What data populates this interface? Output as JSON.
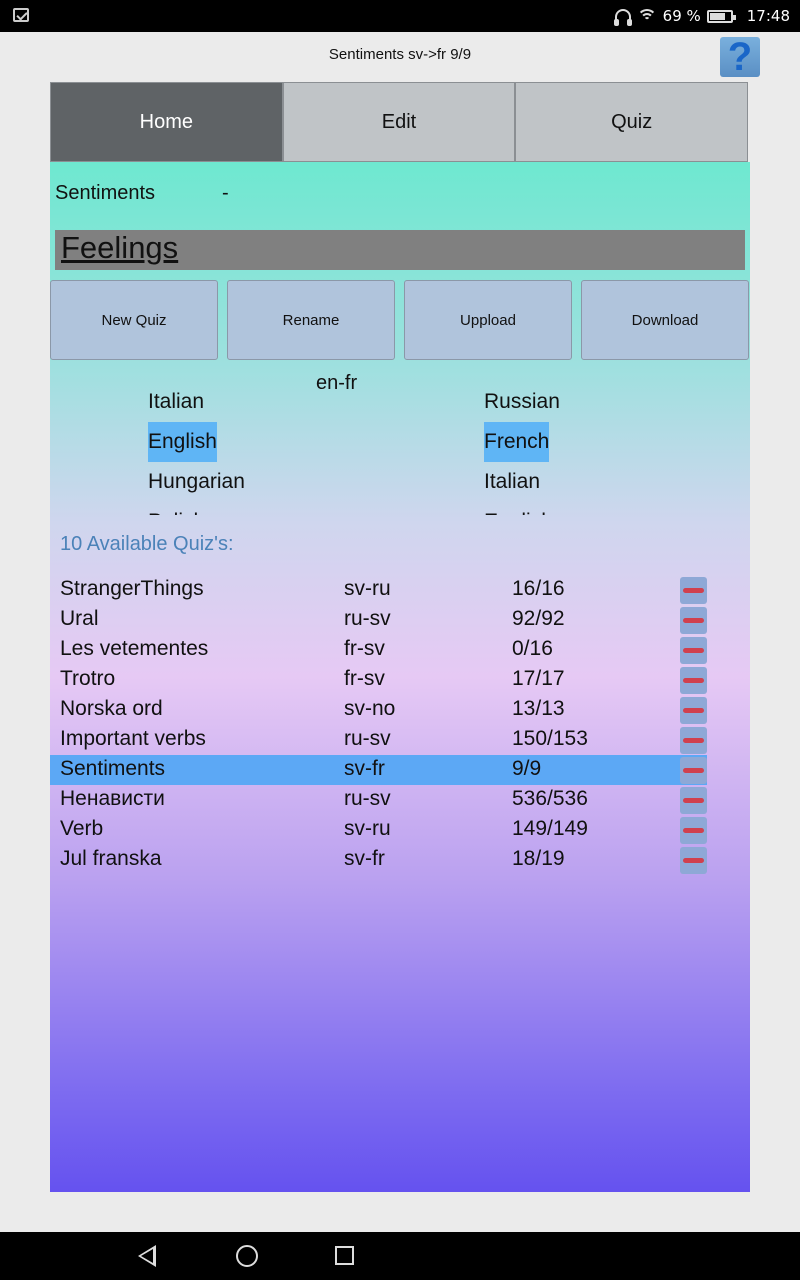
{
  "status_bar": {
    "battery": "69 %",
    "time": "17:48"
  },
  "header": {
    "title": "Sentiments sv->fr 9/9",
    "help_label": "?"
  },
  "tabs": [
    {
      "label": "Home",
      "active": true
    },
    {
      "label": "Edit",
      "active": false
    },
    {
      "label": "Quiz",
      "active": false
    }
  ],
  "current_quiz": {
    "name": "Sentiments",
    "separator": "-"
  },
  "category": {
    "label": "Feelings"
  },
  "actions": {
    "new_quiz": "New Quiz",
    "rename": "Rename",
    "upload": "Uppload",
    "download": "Download"
  },
  "language_picker": {
    "code": "en-fr",
    "left": [
      "Italian",
      "English",
      "Hungarian",
      "Polish"
    ],
    "left_selected": "English",
    "right": [
      "Russian",
      "French",
      "Italian",
      "English"
    ],
    "right_selected": "French"
  },
  "available_label": "10 Available Quiz's:",
  "quizzes": [
    {
      "name": "StrangerThings",
      "pair": "sv-ru",
      "score": "16/16"
    },
    {
      "name": "Ural",
      "pair": "ru-sv",
      "score": "92/92"
    },
    {
      "name": "Les vetementes",
      "pair": "fr-sv",
      "score": "0/16"
    },
    {
      "name": "Trotro",
      "pair": "fr-sv",
      "score": "17/17"
    },
    {
      "name": "Norska ord",
      "pair": "sv-no",
      "score": "13/13"
    },
    {
      "name": "Important verbs",
      "pair": "ru-sv",
      "score": "150/153"
    },
    {
      "name": "Sentiments",
      "pair": "sv-fr",
      "score": "9/9",
      "selected": true
    },
    {
      "name": "Ненависти",
      "pair": "ru-sv",
      "score": "536/536"
    },
    {
      "name": "Verb",
      "pair": "sv-ru",
      "score": "149/149"
    },
    {
      "name": "Jul franska",
      "pair": "sv-fr",
      "score": "18/19"
    }
  ],
  "colors": {
    "selection": "#5ca8f5",
    "tab_active": "#5f6366",
    "tab_inactive": "#c0c4c7",
    "delete_bar": "#d0404e"
  },
  "icons": [
    "notification-icon",
    "headphones-icon",
    "wifi-icon",
    "battery-icon",
    "help-icon",
    "remove-icon",
    "nav-back-icon",
    "nav-home-icon",
    "nav-recent-icon"
  ]
}
